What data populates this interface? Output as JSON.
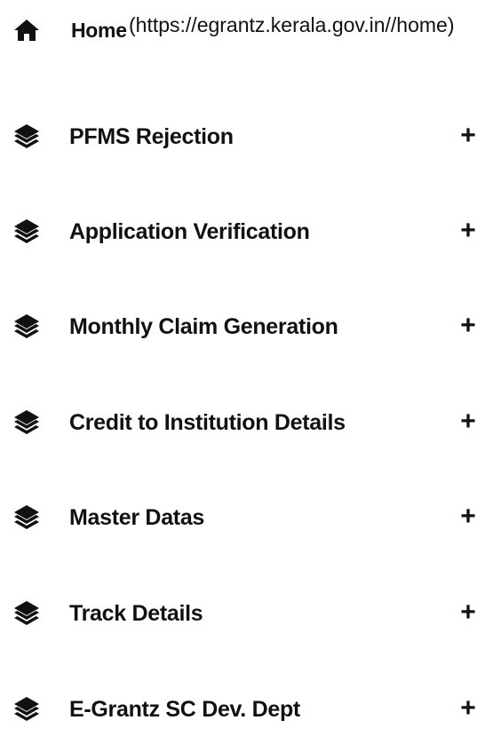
{
  "menu": {
    "home": {
      "label": "Home",
      "url_text": "(https://egrantz.kerala.gov.in//home)",
      "icon": "home-icon"
    },
    "items": [
      {
        "label": "PFMS Rejection",
        "icon": "layers-icon",
        "expand": "+"
      },
      {
        "label": "Application Verification",
        "icon": "layers-icon",
        "expand": "+"
      },
      {
        "label": "Monthly Claim Generation",
        "icon": "layers-icon",
        "expand": "+"
      },
      {
        "label": "Credit to Institution Details",
        "icon": "layers-icon",
        "expand": "+"
      },
      {
        "label": "Master Datas",
        "icon": "layers-icon",
        "expand": "+"
      },
      {
        "label": "Track Details",
        "icon": "layers-icon",
        "expand": "+"
      },
      {
        "label": "E-Grantz SC Dev. Dept",
        "icon": "layers-icon",
        "expand": "+"
      }
    ]
  },
  "colors": {
    "text": "#111111",
    "background": "#ffffff"
  }
}
